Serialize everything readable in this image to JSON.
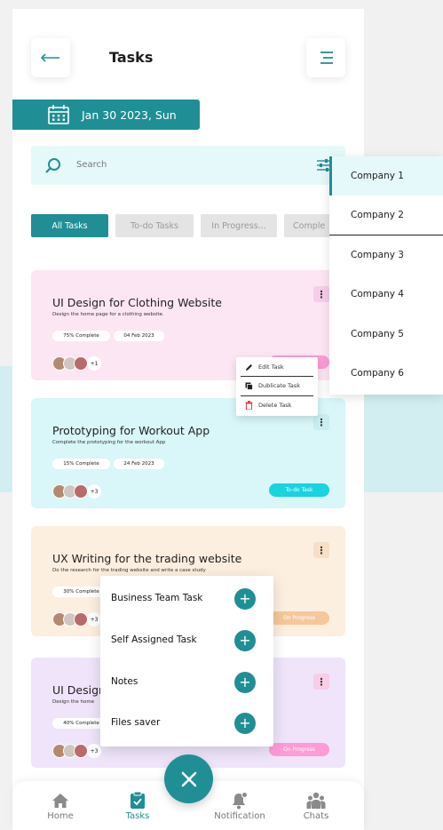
{
  "header": {
    "title": "Tasks"
  },
  "date_bar": {
    "label": "Jan 30 2023, Sun"
  },
  "search": {
    "placeholder": "Search"
  },
  "tabs": [
    {
      "label": "All Tasks",
      "active": true
    },
    {
      "label": "To-do Tasks",
      "active": false
    },
    {
      "label": "In Progress...",
      "active": false
    },
    {
      "label": "Comple",
      "active": false
    }
  ],
  "cards": [
    {
      "title": "UI Design for Clothing Website",
      "description": "Design the  home page for a clothing website.",
      "progress": "75% Complete",
      "date": "04 Feb 2023",
      "extra_members": "+1",
      "status": "",
      "bg": "#fde6f4"
    },
    {
      "title": "Prototyping for Workout App",
      "description": "Complete the prototyping for the workout App",
      "progress": "15% Complete",
      "date": "24 Feb 2023",
      "extra_members": "+3",
      "status": "To-do Task",
      "bg": "#d9f6f8"
    },
    {
      "title": "UX Writing for the trading website",
      "description": "Do the research for the trading website and write a case study",
      "progress": "30% Complete",
      "date": "",
      "extra_members": "+3",
      "status": "On Progress",
      "bg": "#fcefe0"
    },
    {
      "title": "UI Design",
      "description": "Design the  home",
      "progress": "40% Complete",
      "date": "",
      "extra_members": "+3",
      "status": "On Progress",
      "bg": "#efe4fa"
    }
  ],
  "context_menu": {
    "items": [
      "Edit Task",
      "Dublicate Task",
      "Delete Task"
    ]
  },
  "company_dropdown": {
    "items": [
      "Company 1",
      "Company 2",
      "Company 3",
      "Company 4",
      "Company 5",
      "Company 6"
    ],
    "selected": "Company 1"
  },
  "quick_add": {
    "items": [
      "Business Team Task",
      "Self Assigned Task",
      "Notes",
      "Files saver"
    ]
  },
  "bottom_nav": {
    "items": [
      "Home",
      "Tasks",
      "Notification",
      "Chats"
    ],
    "active": "Tasks"
  },
  "colors": {
    "accent": "#1f8f95",
    "cyan_badge": "#18d3e0",
    "pink_badge": "#ff9bd6",
    "orange_badge": "#f4c89a",
    "delete_red": "#e0443b"
  },
  "icons": {
    "back": "arrow-left-icon",
    "menu": "hamburger-icon",
    "calendar": "calendar-icon",
    "search": "search-icon",
    "filter": "sliders-icon",
    "kebab": "more-vertical-icon",
    "edit": "pencil-icon",
    "duplicate": "copy-icon",
    "delete": "trash-icon",
    "plus": "plus-icon",
    "close": "close-icon",
    "home": "home-icon",
    "tasks": "clipboard-check-icon",
    "notification": "bell-icon",
    "chats": "users-icon"
  }
}
